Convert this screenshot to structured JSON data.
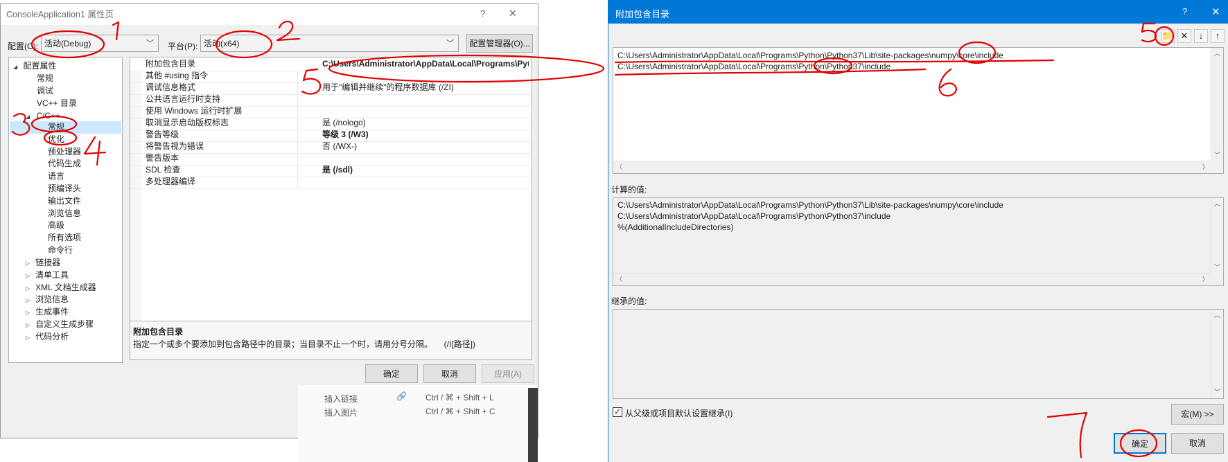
{
  "left_dialog": {
    "title": "ConsoleApplication1 属性页",
    "help_glyph": "?",
    "close_glyph": "✕",
    "config_label": "配置(C):",
    "config_value": "活动(Debug)",
    "platform_label": "平台(P):",
    "platform_value": "活动(x64)",
    "config_manager": "配置管理器(O)...",
    "tree": {
      "root": "配置属性",
      "general": "常规",
      "debug": "调试",
      "vcdirs": "VC++ 目录",
      "cpp": "C/C++",
      "cpp_children": [
        "常规",
        "优化",
        "预处理器",
        "代码生成",
        "语言",
        "预编译头",
        "输出文件",
        "浏览信息",
        "高级",
        "所有选项",
        "命令行"
      ],
      "others": [
        "链接器",
        "清单工具",
        "XML 文档生成器",
        "浏览信息",
        "生成事件",
        "自定义生成步骤",
        "代码分析"
      ]
    },
    "props": [
      {
        "name": "附加包含目录",
        "value": "C:\\Users\\Administrator\\AppData\\Local\\Programs\\Python\\Py"
      },
      {
        "name": "其他 #using 指令",
        "value": ""
      },
      {
        "name": "调试信息格式",
        "value": "用于\"编辑并继续\"的程序数据库 (/ZI)"
      },
      {
        "name": "公共语言运行时支持",
        "value": ""
      },
      {
        "name": "使用 Windows 运行时扩展",
        "value": ""
      },
      {
        "name": "取消显示启动版权标志",
        "value": "是 (/nologo)"
      },
      {
        "name": "警告等级",
        "value": "等级 3 (/W3)"
      },
      {
        "name": "将警告视为错误",
        "value": "否 (/WX-)"
      },
      {
        "name": "警告版本",
        "value": ""
      },
      {
        "name": "SDL 检查",
        "value": "是 (/sdl)"
      },
      {
        "name": "多处理器编译",
        "value": ""
      }
    ],
    "desc_title": "附加包含目录",
    "desc_text": "指定一个或多个要添加到包含路径中的目录；当目录不止一个时，请用分号分隔。     (/I[路径])",
    "ok": "确定",
    "cancel": "取消",
    "apply": "应用(A)"
  },
  "background": {
    "menu_insert_link": "插入链接",
    "menu_insert_link_shortcut": "Ctrl / ⌘ + Shift + L",
    "menu_insert_image": "插入图片",
    "menu_insert_image_shortcut": "Ctrl / ⌘ + Shift + C"
  },
  "right_dialog": {
    "title": "附加包含目录",
    "help_glyph": "?",
    "close_glyph": "✕",
    "entries": [
      "C:\\Users\\Administrator\\AppData\\Local\\Programs\\Python\\Python37\\Lib\\site-packages\\numpy\\core\\include",
      "C:\\Users\\Administrator\\AppData\\Local\\Programs\\Python\\Python37\\include"
    ],
    "computed_label": "计算的值:",
    "computed": [
      "C:\\Users\\Administrator\\AppData\\Local\\Programs\\Python\\Python37\\Lib\\site-packages\\numpy\\core\\include",
      "C:\\Users\\Administrator\\AppData\\Local\\Programs\\Python\\Python37\\include",
      "%(AdditionalIncludeDirectories)"
    ],
    "inherited_label": "继承的值:",
    "inherit_checkbox": "从父级或项目默认设置继承(I)",
    "macro_button": "宏(M) >>",
    "ok": "确定",
    "cancel": "取消"
  },
  "annotations": [
    "1",
    "2",
    "3",
    "4",
    "5",
    "5",
    "6",
    "7"
  ],
  "colors": {
    "accent": "#0078d7",
    "annotation": "#e00000",
    "selection": "#cce8ff",
    "dialog_bg": "#f0f0f0"
  }
}
